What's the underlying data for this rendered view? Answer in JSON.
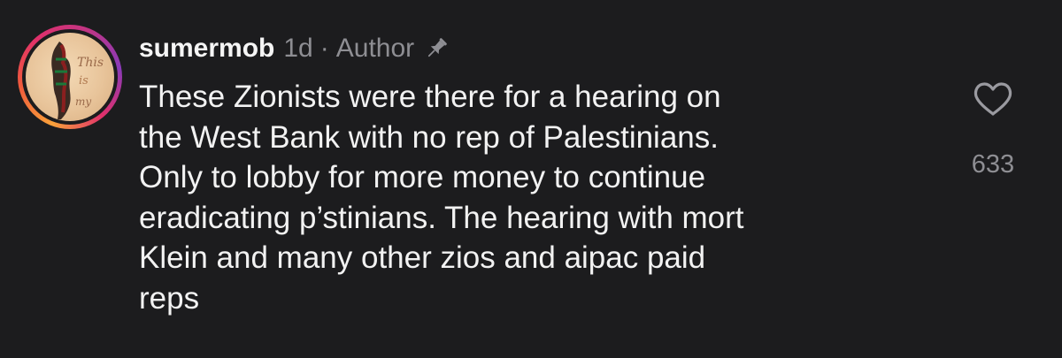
{
  "comment": {
    "username": "sumermob",
    "time_ago": "1d",
    "separator": "·",
    "role_label": "Author",
    "pin_icon": "pin-icon",
    "text": "These Zionists were there for a hearing on\nthe West Bank with no rep of Palestinians.\nOnly to lobby for more money to continue\neradicating p’stinians. The hearing with mort\nKlein and many other zios and aipac paid\nreps",
    "like_icon": "heart-outline-icon",
    "like_count": "633"
  },
  "colors": {
    "background": "#1c1c1e",
    "text_primary": "#f2f2f2",
    "text_secondary": "#8e8e93",
    "story_ring_start": "#f9a13a",
    "story_ring_end": "#c13584"
  }
}
